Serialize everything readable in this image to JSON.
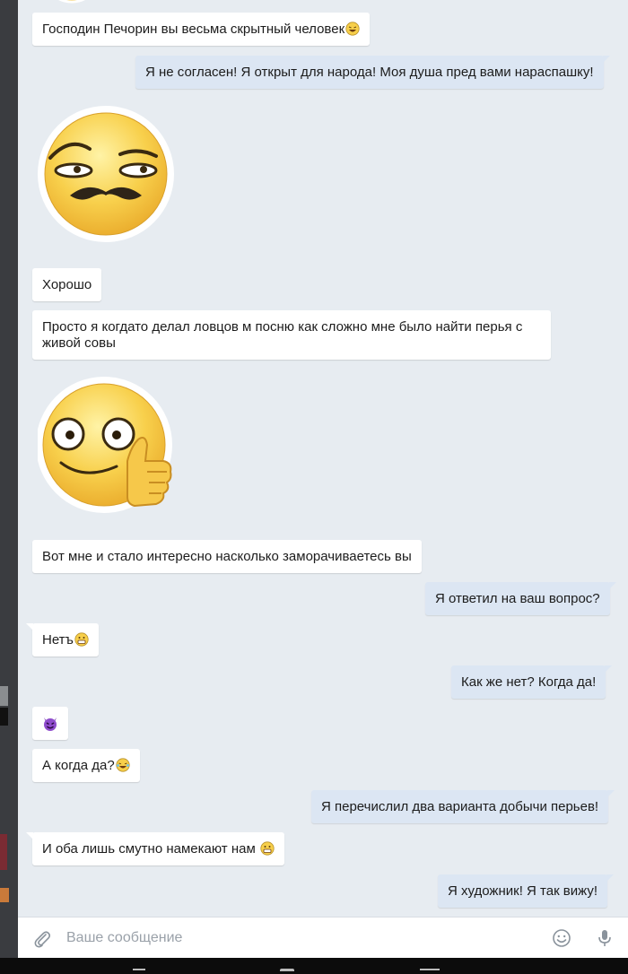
{
  "messages": [
    {
      "text": "Господин Печорин вы весьма скрытный человек",
      "emoji": "laugh-face-icon"
    },
    {
      "text": "Я не согласен! Я открыт для народа! Моя душа пред вами нараспашку!"
    },
    {
      "sticker": "mustache-smirk-sticker"
    },
    {
      "text": "Хорошо"
    },
    {
      "text": "Просто я когдато делал ловцов м посню как сложно мне было найти перья с живой совы"
    },
    {
      "sticker": "thumbs-up-sticker"
    },
    {
      "text": "Вот мне и стало интересно насколько заморачиваетесь вы"
    },
    {
      "text": "Я ответил на ваш вопрос?"
    },
    {
      "text": "Нетъ",
      "emoji": "grin-face-icon"
    },
    {
      "text": "Как же нет? Когда да!"
    },
    {
      "emoji": "purple-devil-icon"
    },
    {
      "text": "А когда да?",
      "emoji": "laugh-tears-icon"
    },
    {
      "text": "Я перечислил два варианта добычи перьев!"
    },
    {
      "text": "И оба лишь смутно намекают нам",
      "emoji": "grin-face-icon"
    },
    {
      "text": "Я художник! Я так вижу!"
    }
  ],
  "composer": {
    "placeholder": "Ваше сообщение",
    "attach_icon": "paperclip-icon",
    "emoji_icon": "smiley-icon",
    "mic_icon": "microphone-icon"
  },
  "colors": {
    "background": "#e7ecf1",
    "incoming_bubble": "#ffffff",
    "outgoing_bubble": "#dce6f3"
  }
}
